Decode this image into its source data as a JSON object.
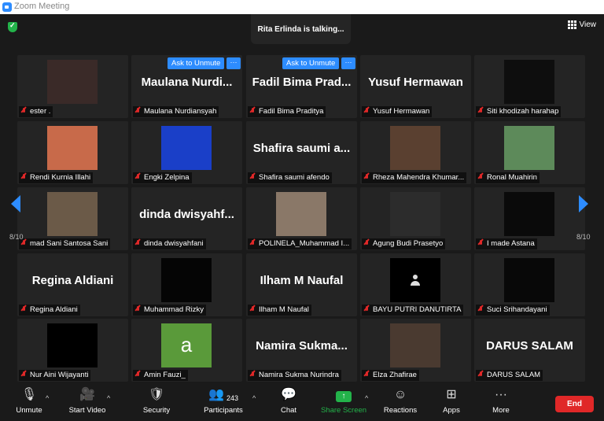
{
  "window": {
    "title": "Zoom Meeting"
  },
  "talking_banner": "Rita Erlinda is talking...",
  "view_label": "View",
  "pagination": {
    "left": "8/10",
    "right": "8/10"
  },
  "ask_label": "Ask to Unmute",
  "more_dots": "···",
  "tiles": [
    {
      "label": "ester .",
      "big": "",
      "photo": "#3a2a28"
    },
    {
      "label": "Maulana Nurdiansyah",
      "big": "Maulana Nurdi...",
      "ask": true
    },
    {
      "label": "Fadil Bima Praditya",
      "big": "Fadil Bima Prad...",
      "ask": true
    },
    {
      "label": "Yusuf Hermawan",
      "big": "Yusuf Hermawan"
    },
    {
      "label": "Siti khodizah harahap",
      "big": "",
      "photo": "#0e0e0e"
    },
    {
      "label": "Rendi Kurnia Illahi",
      "big": "",
      "photo": "#c86a4a"
    },
    {
      "label": "Engki Zelpina",
      "big": "",
      "photo": "#1a3fc8"
    },
    {
      "label": "Shafira saumi afendo",
      "big": "Shafira saumi a..."
    },
    {
      "label": "Rheza Mahendra Khumar...",
      "big": "",
      "photo": "#5a4030"
    },
    {
      "label": "Ronal Muahirin",
      "big": "",
      "photo": "#5d8a5a"
    },
    {
      "label": "mad Sani Santosa Sani",
      "big": "",
      "photo": "#6b5a48"
    },
    {
      "label": "dinda dwisyahfani",
      "big": "dinda dwisyahf..."
    },
    {
      "label": "POLINELA_Muhammad I...",
      "big": "",
      "photo": "#8a7868"
    },
    {
      "label": "Agung Budi Prasetyo",
      "big": "",
      "photo": "#2c2c2c"
    },
    {
      "label": "I made Astana",
      "big": "",
      "photo": "#0a0a0a"
    },
    {
      "label": "Regina Aldiani",
      "big": "Regina Aldiani"
    },
    {
      "label": "Muhammad Rizky",
      "big": "",
      "photo": "#050505"
    },
    {
      "label": "Ilham M Naufal",
      "big": "Ilham M Naufal"
    },
    {
      "label": "BAYU PUTRI DANUTIRTA",
      "big": "",
      "photo": "#000000",
      "avatar": true
    },
    {
      "label": "Suci Srihandayani",
      "big": "",
      "photo": "#080808"
    },
    {
      "label": "Nur Aini Wijayanti",
      "big": "",
      "photo": "#000000"
    },
    {
      "label": "Amin Fauzi_",
      "big": "",
      "photo": "#5a9a3a",
      "letter": "a"
    },
    {
      "label": "Namira Sukma Nurindra",
      "big": "Namira Sukma..."
    },
    {
      "label": "Elza Zhafirae",
      "big": "",
      "photo": "#4a3a30"
    },
    {
      "label": "DARUS SALAM",
      "big": "DARUS SALAM"
    }
  ],
  "toolbar": {
    "unmute": "Unmute",
    "start_video": "Start Video",
    "security": "Security",
    "participants": "Participants",
    "participants_count": "243",
    "chat": "Chat",
    "share_screen": "Share Screen",
    "reactions": "Reactions",
    "apps": "Apps",
    "more": "More",
    "end": "End"
  },
  "colors": {
    "accent": "#2d8cff",
    "share": "#23b34a",
    "end": "#e02828",
    "muted": "#e02828"
  }
}
